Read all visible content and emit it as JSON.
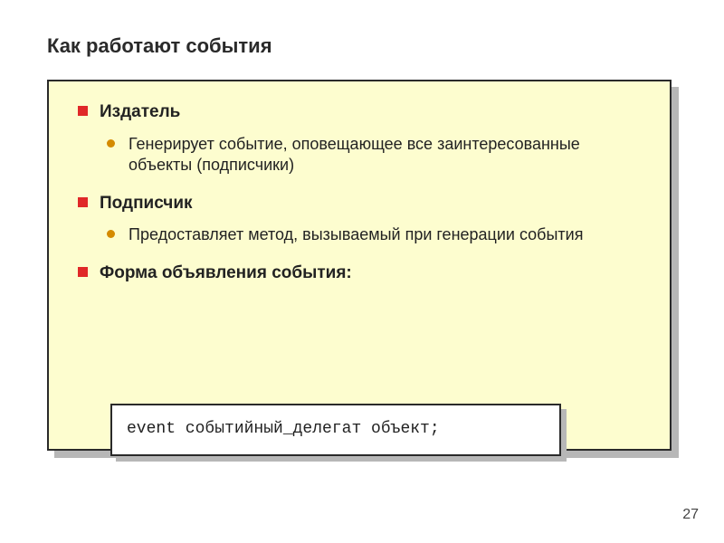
{
  "title": "Как работают события",
  "bullets": {
    "b1": "Издатель",
    "b1s": "Генерирует событие, оповещающее все заинтересованные объекты (подписчики)",
    "b2": "Подписчик",
    "b2s": "Предоставляет метод, вызываемый при генерации события",
    "b3": "Форма объявления события:"
  },
  "code": "event событийный_делегат объект;",
  "page_number": "27"
}
